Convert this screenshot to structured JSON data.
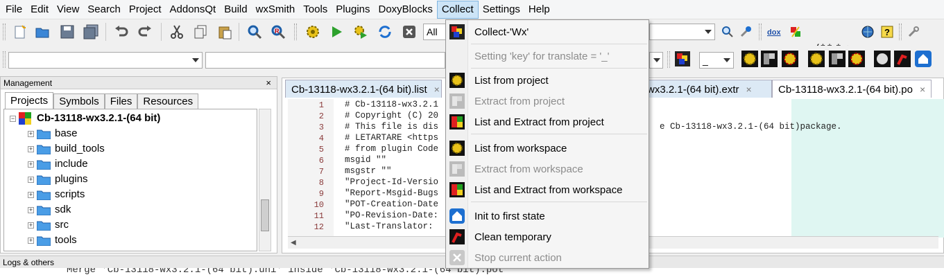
{
  "menubar": {
    "items": [
      "File",
      "Edit",
      "View",
      "Search",
      "Project",
      "AddonsQt",
      "Build",
      "wxSmith",
      "Tools",
      "Plugins",
      "DoxyBlocks",
      "Collect",
      "Settings",
      "Help"
    ],
    "active": "Collect"
  },
  "toolbar": {
    "target_combo": "All",
    "underscore_combo": "_",
    "comment_buttons": [
      "/**",
      "*<"
    ],
    "icons": [
      "new-file-icon",
      "open-icon",
      "save-icon",
      "save-all-icon",
      "undo-icon",
      "redo-icon",
      "cut-icon",
      "copy-icon",
      "paste-icon",
      "find-icon",
      "replace-icon",
      "build-icon",
      "run-icon",
      "build-run-icon",
      "rebuild-icon",
      "abort-icon",
      "doxygen-icon",
      "help-icon"
    ]
  },
  "management": {
    "title": "Management",
    "close": "×",
    "tabs": [
      "Projects",
      "Symbols",
      "Files",
      "Resources"
    ],
    "active_tab": "Projects",
    "project_name": "Cb-13118-wx3.2.1-(64 bit)",
    "folders": [
      "base",
      "build_tools",
      "include",
      "plugins",
      "scripts",
      "sdk",
      "src",
      "tools"
    ]
  },
  "editor": {
    "tabs": [
      {
        "label": "Cb-13118-wx3.2.1-(64 bit).list",
        "close": "×"
      },
      {
        "label": "-wx3.2.1-(64 bit).extr",
        "close": "×"
      },
      {
        "label": "Cb-13118-wx3.2.1-(64 bit).po",
        "close": "×"
      }
    ],
    "line_numbers": [
      "1",
      "2",
      "3",
      "4",
      "5",
      "6",
      "7",
      "8",
      "9",
      "10",
      "11",
      "12"
    ],
    "lines": [
      "# Cb-13118-wx3.2.1",
      "# Copyright (C) 20",
      "# This file is dis",
      "# LETARTARE <https",
      "# from plugin Code",
      "msgid \"\"",
      "msgstr \"\"",
      "\"Project-Id-Versio",
      "\"Report-Msgid-Bugs",
      "\"POT-Creation-Date",
      "\"PO-Revision-Date:",
      "\"Last-Translator: "
    ],
    "right_fragment": "e Cb-13118-wx3.2.1-(64 bit)package."
  },
  "collect_menu": {
    "items": [
      {
        "label": "Collect-'Wx'",
        "enabled": true,
        "icon": "collect-wx-icon"
      },
      {
        "label": "Setting 'key' for translate = '_'",
        "enabled": false,
        "icon": ""
      },
      {
        "label": "List from project",
        "enabled": true,
        "icon": "gear-list-icon"
      },
      {
        "label": "Extract from project",
        "enabled": false,
        "icon": "extract-icon"
      },
      {
        "label": "List and Extract from project",
        "enabled": true,
        "icon": "list-extract-icon"
      },
      {
        "label": "List from workspace",
        "enabled": true,
        "icon": "gear-list-icon"
      },
      {
        "label": "Extract from workspace",
        "enabled": false,
        "icon": "extract-icon"
      },
      {
        "label": "List and Extract from workspace",
        "enabled": true,
        "icon": "list-extract-icon"
      },
      {
        "label": "Init to first state",
        "enabled": true,
        "icon": "home-icon"
      },
      {
        "label": "Clean temporary",
        "enabled": true,
        "icon": "clean-icon"
      },
      {
        "label": "Stop current action",
        "enabled": false,
        "icon": "stop-icon"
      }
    ]
  },
  "logs": {
    "title": "Logs & others",
    "line": "Merge 'Cb-13118-wx3.2.1-(64 bit).uni' inside 'Cb-13118-wx3.2.1-(64 bit).pot'"
  },
  "colors": {
    "menu_highlight": "#cce4f7",
    "editor_tab_active": "#ffffff",
    "editor_tab_inactive": "#dce9f5",
    "code_highlight": "#dff6f2"
  }
}
